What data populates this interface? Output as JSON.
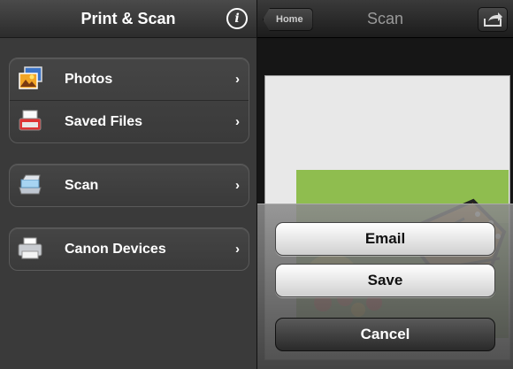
{
  "left": {
    "title": "Print & Scan",
    "info_icon": "info-icon",
    "groups": [
      {
        "items": [
          {
            "label": "Photos",
            "icon": "photos-icon"
          },
          {
            "label": "Saved Files",
            "icon": "printer-tray-icon"
          }
        ]
      },
      {
        "items": [
          {
            "label": "Scan",
            "icon": "scanner-icon"
          }
        ]
      },
      {
        "items": [
          {
            "label": "Canon Devices",
            "icon": "printer-icon"
          }
        ]
      }
    ],
    "chevron": "›"
  },
  "right": {
    "title": "Scan",
    "home_label": "Home",
    "share_icon": "share-icon",
    "sheet": {
      "email_label": "Email",
      "save_label": "Save",
      "cancel_label": "Cancel"
    }
  },
  "colors": {
    "panel_bg": "#3a3a3a",
    "button_light": "#ffffff",
    "button_dark": "#2a2a2a"
  }
}
